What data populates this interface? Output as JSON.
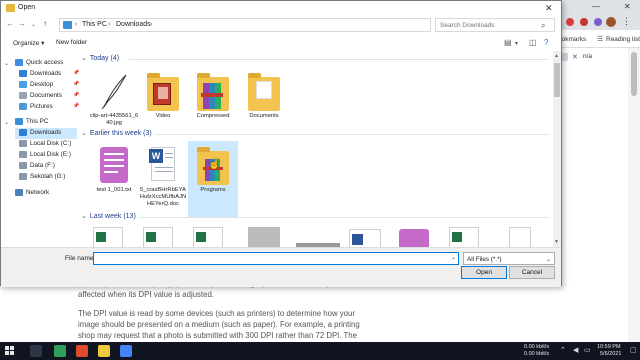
{
  "browser": {
    "bookmarks": [
      "ookmarks",
      "Reading list"
    ],
    "ext_label": "n/a",
    "article_paragraphs": [
      "(header). The actual quality (resolution) of the image (within the file itself) is not affected when its DPI value is adjusted.",
      "The DPI value is read by some devices (such as printers) to determine how your image should be presented on a medium (such as paper). For example, a printing shop may request that a photo is submitted with 300 DPI rather than 72 DPI. The"
    ]
  },
  "dialog": {
    "title": "Open",
    "address": {
      "segments": [
        "This PC",
        "Downloads"
      ]
    },
    "search": {
      "placeholder": "Search Downloads"
    },
    "commands": {
      "organize": "Organize ▾",
      "new_folder": "New folder"
    },
    "nav": {
      "items": [
        {
          "label": "Quick access",
          "color": "#3b8ee0",
          "pinned": false
        },
        {
          "label": "Downloads",
          "color": "#2f7fd4",
          "pinned": true
        },
        {
          "label": "Desktop",
          "color": "#4aa0e8",
          "pinned": true
        },
        {
          "label": "Documents",
          "color": "#9aa4b0",
          "pinned": true
        },
        {
          "label": "Pictures",
          "color": "#4f9ad6",
          "pinned": true
        },
        {
          "label": "This PC",
          "color": "#3a8fd9",
          "pinned": false
        },
        {
          "label": "Downloads",
          "color": "#2f7fd4",
          "pinned": false
        },
        {
          "label": "Local Disk (C:)",
          "color": "#8a98a8",
          "pinned": false
        },
        {
          "label": "Local Disk (E:)",
          "color": "#8a98a8",
          "pinned": false
        },
        {
          "label": "Data (F:)",
          "color": "#8a98a8",
          "pinned": false
        },
        {
          "label": "Sekolah (G:)",
          "color": "#8a98a8",
          "pinned": false
        },
        {
          "label": "Network",
          "color": "#4a7fb8",
          "pinned": false
        }
      ]
    },
    "groups": [
      {
        "title": "Today (4)",
        "files": [
          {
            "name": "clip-art-4435561_640.jpg",
            "kind": "image"
          },
          {
            "name": "Video",
            "kind": "folder-video"
          },
          {
            "name": "Compressed",
            "kind": "folder-rar"
          },
          {
            "name": "Documents",
            "kind": "folder-docs"
          }
        ]
      },
      {
        "title": "Earlier this week (3)",
        "files": [
          {
            "name": "test 1_001.txt",
            "kind": "txt"
          },
          {
            "name": "5_crasBHrRbEYAHufzXccMUfbAJNHEYerQ.doc",
            "kind": "word"
          },
          {
            "name": "Programs",
            "kind": "folder-rar"
          }
        ]
      },
      {
        "title": "Last week (13)",
        "files": []
      }
    ],
    "bottom": {
      "filename_label": "File name:",
      "filename_value": "",
      "filetype": "All Files (*.*)",
      "open_label": "Open",
      "cancel_label": "Cancel"
    }
  },
  "taskbar": {
    "net_up": "0.00 kbit/s",
    "net_down": "0.00 kbit/s",
    "time": "10:59 PM",
    "date": "5/6/2021"
  }
}
